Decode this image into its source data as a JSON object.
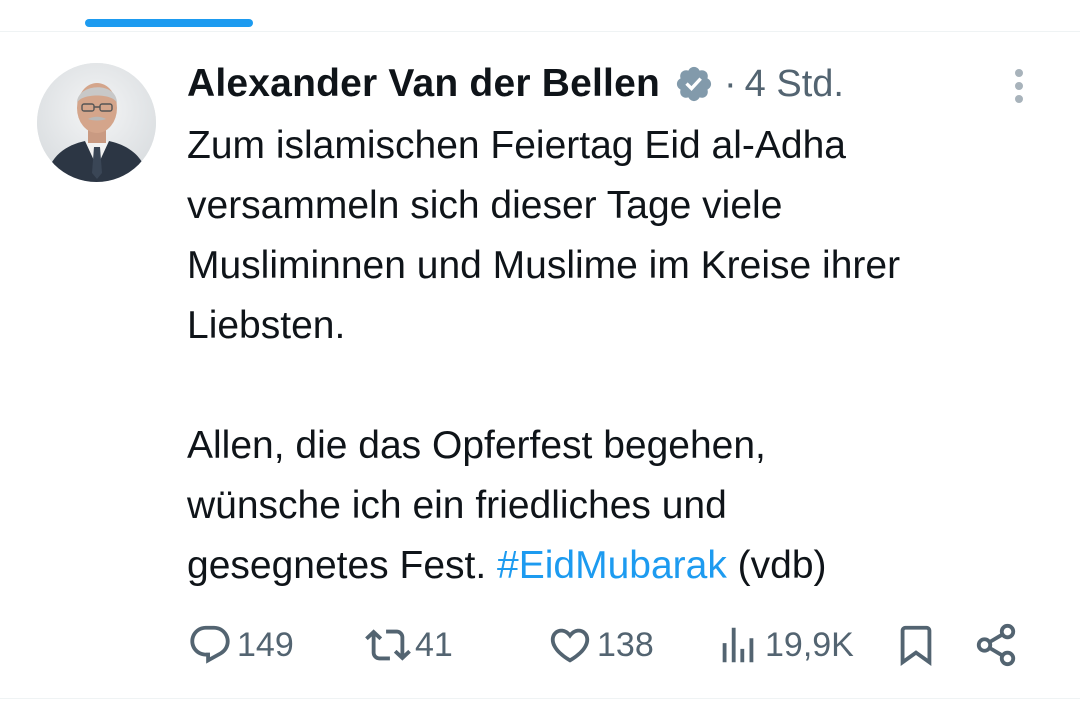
{
  "colors": {
    "accent": "#1d9bf0",
    "text_primary": "#0f1419",
    "text_secondary": "#536471",
    "verified_badge": "#829aab"
  },
  "tweet": {
    "author_name": "Alexander Van der Bellen",
    "verified_icon": "verified-badge-icon",
    "separator": "·",
    "timestamp": "4 Std.",
    "text_part1": "Zum islamischen Feiertag Eid al-Adha\nversammeln sich dieser Tage viele\nMusliminnen und Muslime im Kreise ihrer\nLiebsten.\n\nAllen, die das Opferfest begehen,\nwünsche ich ein friedliches und\ngesegnetes Fest. ",
    "hashtag": "#EidMubarak",
    "text_part2": " (vdb)"
  },
  "actions": {
    "reply_count": "149",
    "retweet_count": "41",
    "like_count": "138",
    "views_count": "19,9K"
  },
  "icons": {
    "reply": "reply-icon",
    "retweet": "retweet-icon",
    "like": "heart-icon",
    "views": "views-icon",
    "bookmark": "bookmark-icon",
    "share": "share-icon",
    "more": "more-icon"
  }
}
